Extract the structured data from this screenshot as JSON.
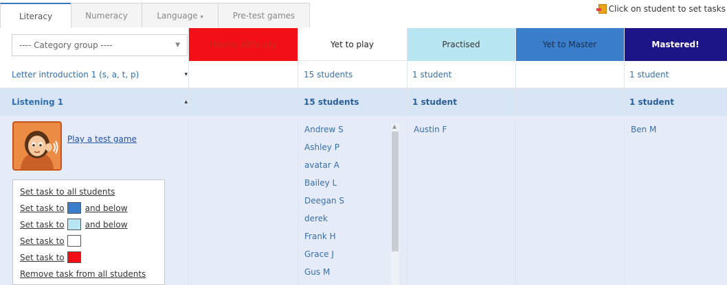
{
  "tabs": [
    {
      "label": "Literacy"
    },
    {
      "label": "Numeracy"
    },
    {
      "label": "Language",
      "caret": "▾"
    },
    {
      "label": "Pre-test games"
    }
  ],
  "instruction": "Click on student to set tasks",
  "category_select": {
    "value": "---- Category group ----",
    "arrow": "▼"
  },
  "columns": {
    "having_difficulty": "Having difficulty",
    "yet_to_play": "Yet to play",
    "practised": "Practised",
    "yet_to_master": "Yet to Master",
    "mastered": "Mastered!"
  },
  "rows": [
    {
      "label": "Letter introduction 1 (s, a, t, p)",
      "caret": "▾",
      "yet_to_play": "15 students",
      "practised": "1 student",
      "mastered": "1 student"
    },
    {
      "label": "Listening 1",
      "caret": "▴",
      "yet_to_play": "15 students",
      "practised": "1 student",
      "mastered": "1 student"
    }
  ],
  "play_test_game": "Play a test game",
  "task_menu": {
    "all": "Set task to all students",
    "blue_prefix": "Set task to",
    "blue_suffix": "and below",
    "lightblue_prefix": "Set task to",
    "lightblue_suffix": "and below",
    "white_prefix": "Set task to",
    "red_prefix": "Set task to",
    "remove": "Remove task from all students"
  },
  "students": {
    "yet_to_play": [
      "Andrew S",
      "Ashley P",
      "avatar A",
      "Bailey L",
      "Deegan S",
      "derek",
      "Frank H",
      "Grace J",
      "Gus M"
    ],
    "practised": [
      "Austin F"
    ],
    "mastered": [
      "Ben M"
    ]
  },
  "colors": {
    "red": "#f20f16",
    "light_blue": "#b8e6f2",
    "blue": "#3a7ecb",
    "navy": "#1b1587"
  }
}
